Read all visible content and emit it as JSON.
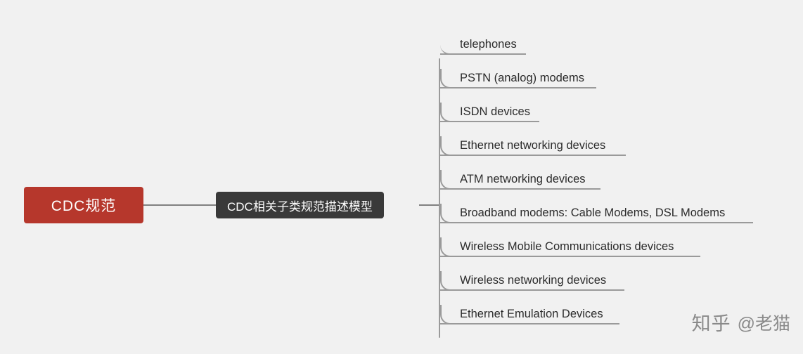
{
  "diagram": {
    "type": "mindmap",
    "root": {
      "label": "CDC规范",
      "color": "#b6372c",
      "text_color": "#ffffff"
    },
    "branch": {
      "label": "CDC相关子类规范描述模型",
      "color": "#393939",
      "text_color": "#ffffff"
    },
    "leaves": [
      {
        "label": "telephones"
      },
      {
        "label": "PSTN (analog) modems"
      },
      {
        "label": "ISDN devices"
      },
      {
        "label": "Ethernet networking devices"
      },
      {
        "label": "ATM networking devices"
      },
      {
        "label": "Broadband modems: Cable Modems, DSL Modems"
      },
      {
        "label": "Wireless Mobile Communications devices"
      },
      {
        "label": "Wireless networking devices"
      },
      {
        "label": "Ethernet Emulation Devices"
      }
    ],
    "line_color": "#9a9a9a",
    "background": "#f1f1f1"
  },
  "watermark": {
    "site": "知乎",
    "user": "@老猫"
  }
}
